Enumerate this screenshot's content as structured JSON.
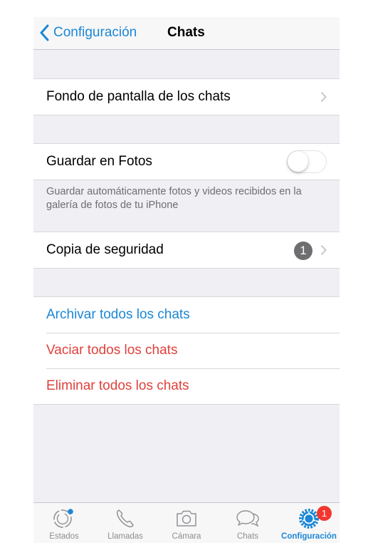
{
  "navbar": {
    "back_label": "Configuración",
    "title": "Chats"
  },
  "sections": {
    "wallpaper": {
      "label": "Fondo de pantalla de los chats"
    },
    "save_to_photos": {
      "label": "Guardar en Fotos",
      "toggle_on": false,
      "footer": "Guardar automáticamente fotos y videos recibidos en la galería de fotos de tu iPhone"
    },
    "backup": {
      "label": "Copia de seguridad",
      "badge": "1"
    },
    "actions": [
      {
        "label": "Archivar todos los chats",
        "color": "#1b87d6"
      },
      {
        "label": "Vaciar todos los chats",
        "color": "#e0413c"
      },
      {
        "label": "Eliminar todos los chats",
        "color": "#e0413c"
      }
    ]
  },
  "tabbar": {
    "tabs": [
      {
        "label": "Estados",
        "icon": "status-icon",
        "active": false
      },
      {
        "label": "Llamadas",
        "icon": "phone-icon",
        "active": false
      },
      {
        "label": "Cámara",
        "icon": "camera-icon",
        "active": false
      },
      {
        "label": "Chats",
        "icon": "chat-bubbles-icon",
        "active": false
      },
      {
        "label": "Configuración",
        "icon": "gear-icon",
        "active": true,
        "badge": "1"
      }
    ]
  },
  "colors": {
    "accent": "#1b87d6",
    "destructive": "#e0413c",
    "badge_red": "#f2372f",
    "background": "#efeff4"
  }
}
